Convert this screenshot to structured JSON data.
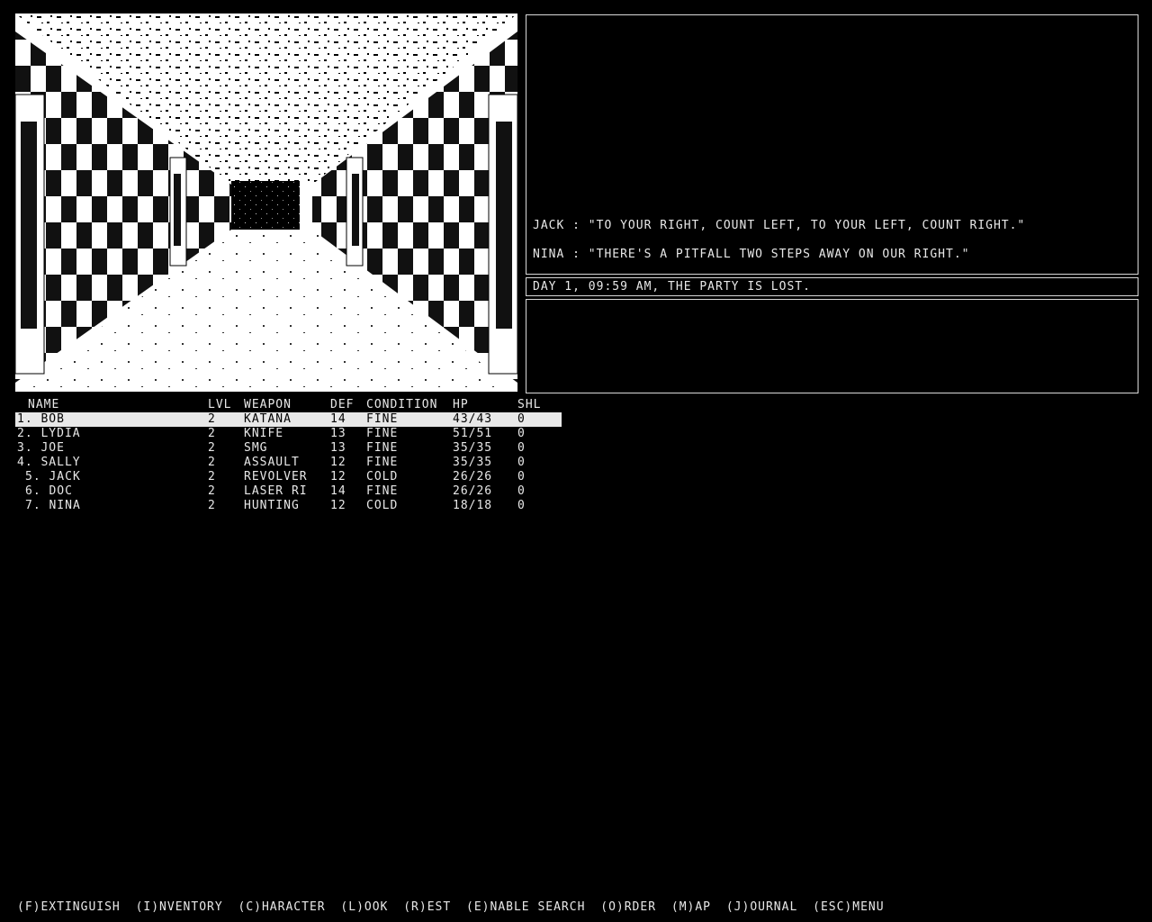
{
  "messages": [
    "JACK : \"TO YOUR RIGHT, COUNT LEFT, TO YOUR LEFT, COUNT RIGHT.\"",
    "NINA : \"THERE'S A PITFALL TWO STEPS AWAY ON OUR RIGHT.\""
  ],
  "status": "DAY 1, 09:59 AM, THE PARTY IS LOST.",
  "roster": {
    "headers": {
      "name": "NAME",
      "lvl": "LVL",
      "weapon": "WEAPON",
      "def": "DEF",
      "condition": "CONDITION",
      "hp": "HP",
      "shl": "SHL"
    },
    "members": [
      {
        "name": "1. BOB",
        "lvl": "2",
        "weapon": "KATANA",
        "def": "14",
        "condition": "FINE",
        "hp": "43/43",
        "shl": "0"
      },
      {
        "name": "2. LYDIA",
        "lvl": "2",
        "weapon": "KNIFE",
        "def": "13",
        "condition": "FINE",
        "hp": "51/51",
        "shl": "0"
      },
      {
        "name": "3. JOE",
        "lvl": "2",
        "weapon": "SMG",
        "def": "13",
        "condition": "FINE",
        "hp": "35/35",
        "shl": "0"
      },
      {
        "name": "4. SALLY",
        "lvl": "2",
        "weapon": "ASSAULT",
        "def": "12",
        "condition": "FINE",
        "hp": "35/35",
        "shl": "0"
      },
      {
        "name": "5. JACK",
        "lvl": "2",
        "weapon": "REVOLVER",
        "def": "12",
        "condition": "COLD",
        "hp": "26/26",
        "shl": "0"
      },
      {
        "name": "6. DOC",
        "lvl": "2",
        "weapon": "LASER RI",
        "def": "14",
        "condition": "FINE",
        "hp": "26/26",
        "shl": "0"
      },
      {
        "name": "7. NINA",
        "lvl": "2",
        "weapon": "HUNTING",
        "def": "12",
        "condition": "COLD",
        "hp": "18/18",
        "shl": "0"
      }
    ]
  },
  "commands": [
    "(F)EXTINGUISH",
    "(I)NVENTORY",
    "(C)HARACTER",
    "(L)OOK",
    "(R)EST",
    "(E)NABLE SEARCH",
    "(O)RDER",
    "(M)AP",
    "(J)OURNAL",
    "(ESC)MENU"
  ]
}
